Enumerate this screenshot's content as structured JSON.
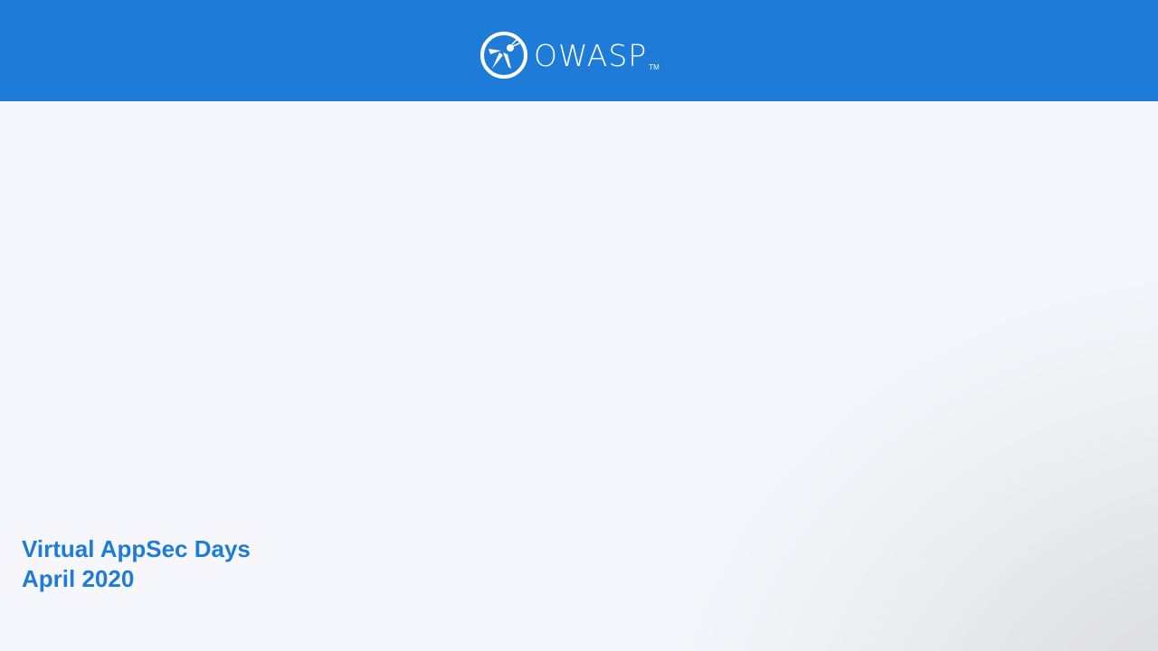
{
  "header": {
    "logo_text": "OWASP",
    "trademark": "TM",
    "color": "#1e7bd8"
  },
  "title": {
    "line1": "Virtual AppSec Days",
    "line2": "April 2020"
  }
}
